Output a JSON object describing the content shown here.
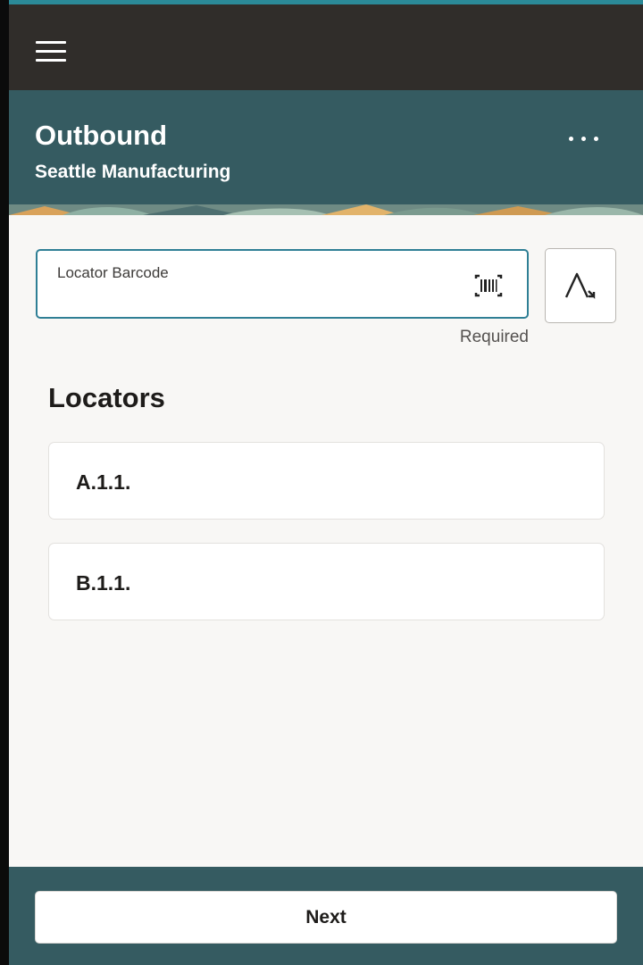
{
  "header": {
    "title": "Outbound",
    "subtitle": "Seattle Manufacturing"
  },
  "icons": {
    "menu": "hamburger-menu-icon",
    "more": "more-options-icon",
    "scan": "barcode-scan-icon",
    "keyboard": "text-input-toggle-icon"
  },
  "form": {
    "barcode_label": "Locator Barcode",
    "barcode_value": "",
    "required_text": "Required"
  },
  "locators": {
    "title": "Locators",
    "items": [
      {
        "label": "A.1.1."
      },
      {
        "label": "B.1.1."
      }
    ]
  },
  "footer": {
    "next_label": "Next"
  },
  "colors": {
    "top_bar": "#302d2a",
    "header_bg": "#355b61",
    "field_border": "#2f7f95",
    "page_bg": "#f8f7f5"
  }
}
